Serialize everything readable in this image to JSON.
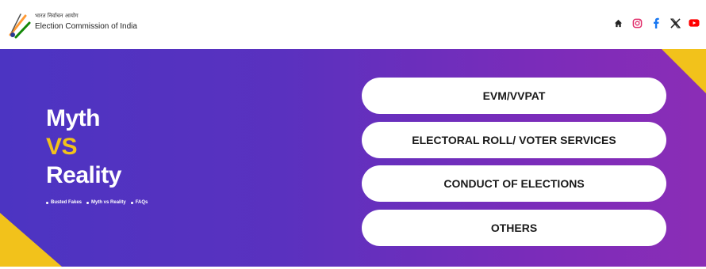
{
  "header": {
    "brand_hindi": "भारत निर्वाचन आयोग",
    "brand_english": "Election Commission of India",
    "social_icons": [
      "home-icon",
      "instagram-icon",
      "facebook-icon",
      "x-icon",
      "youtube-icon"
    ],
    "social_colors": {
      "instagram": "#e1306c",
      "facebook": "#1877f2",
      "x": "#222222",
      "youtube": "#ff0000"
    }
  },
  "hero": {
    "title_line1": "Myth",
    "title_line2": "VS",
    "title_line3": "Reality",
    "breadcrumbs": [
      "Busted Fakes",
      "Myth vs Reality",
      "FAQs"
    ],
    "buttons": [
      "EVM/VVPAT",
      "ELECTORAL ROLL/ VOTER SERVICES",
      "CONDUCT OF ELECTIONS",
      "OTHERS"
    ],
    "colors": {
      "accent_yellow": "#f2c21b",
      "gradient_start": "#4c34c2",
      "gradient_end": "#8b2db6"
    }
  }
}
